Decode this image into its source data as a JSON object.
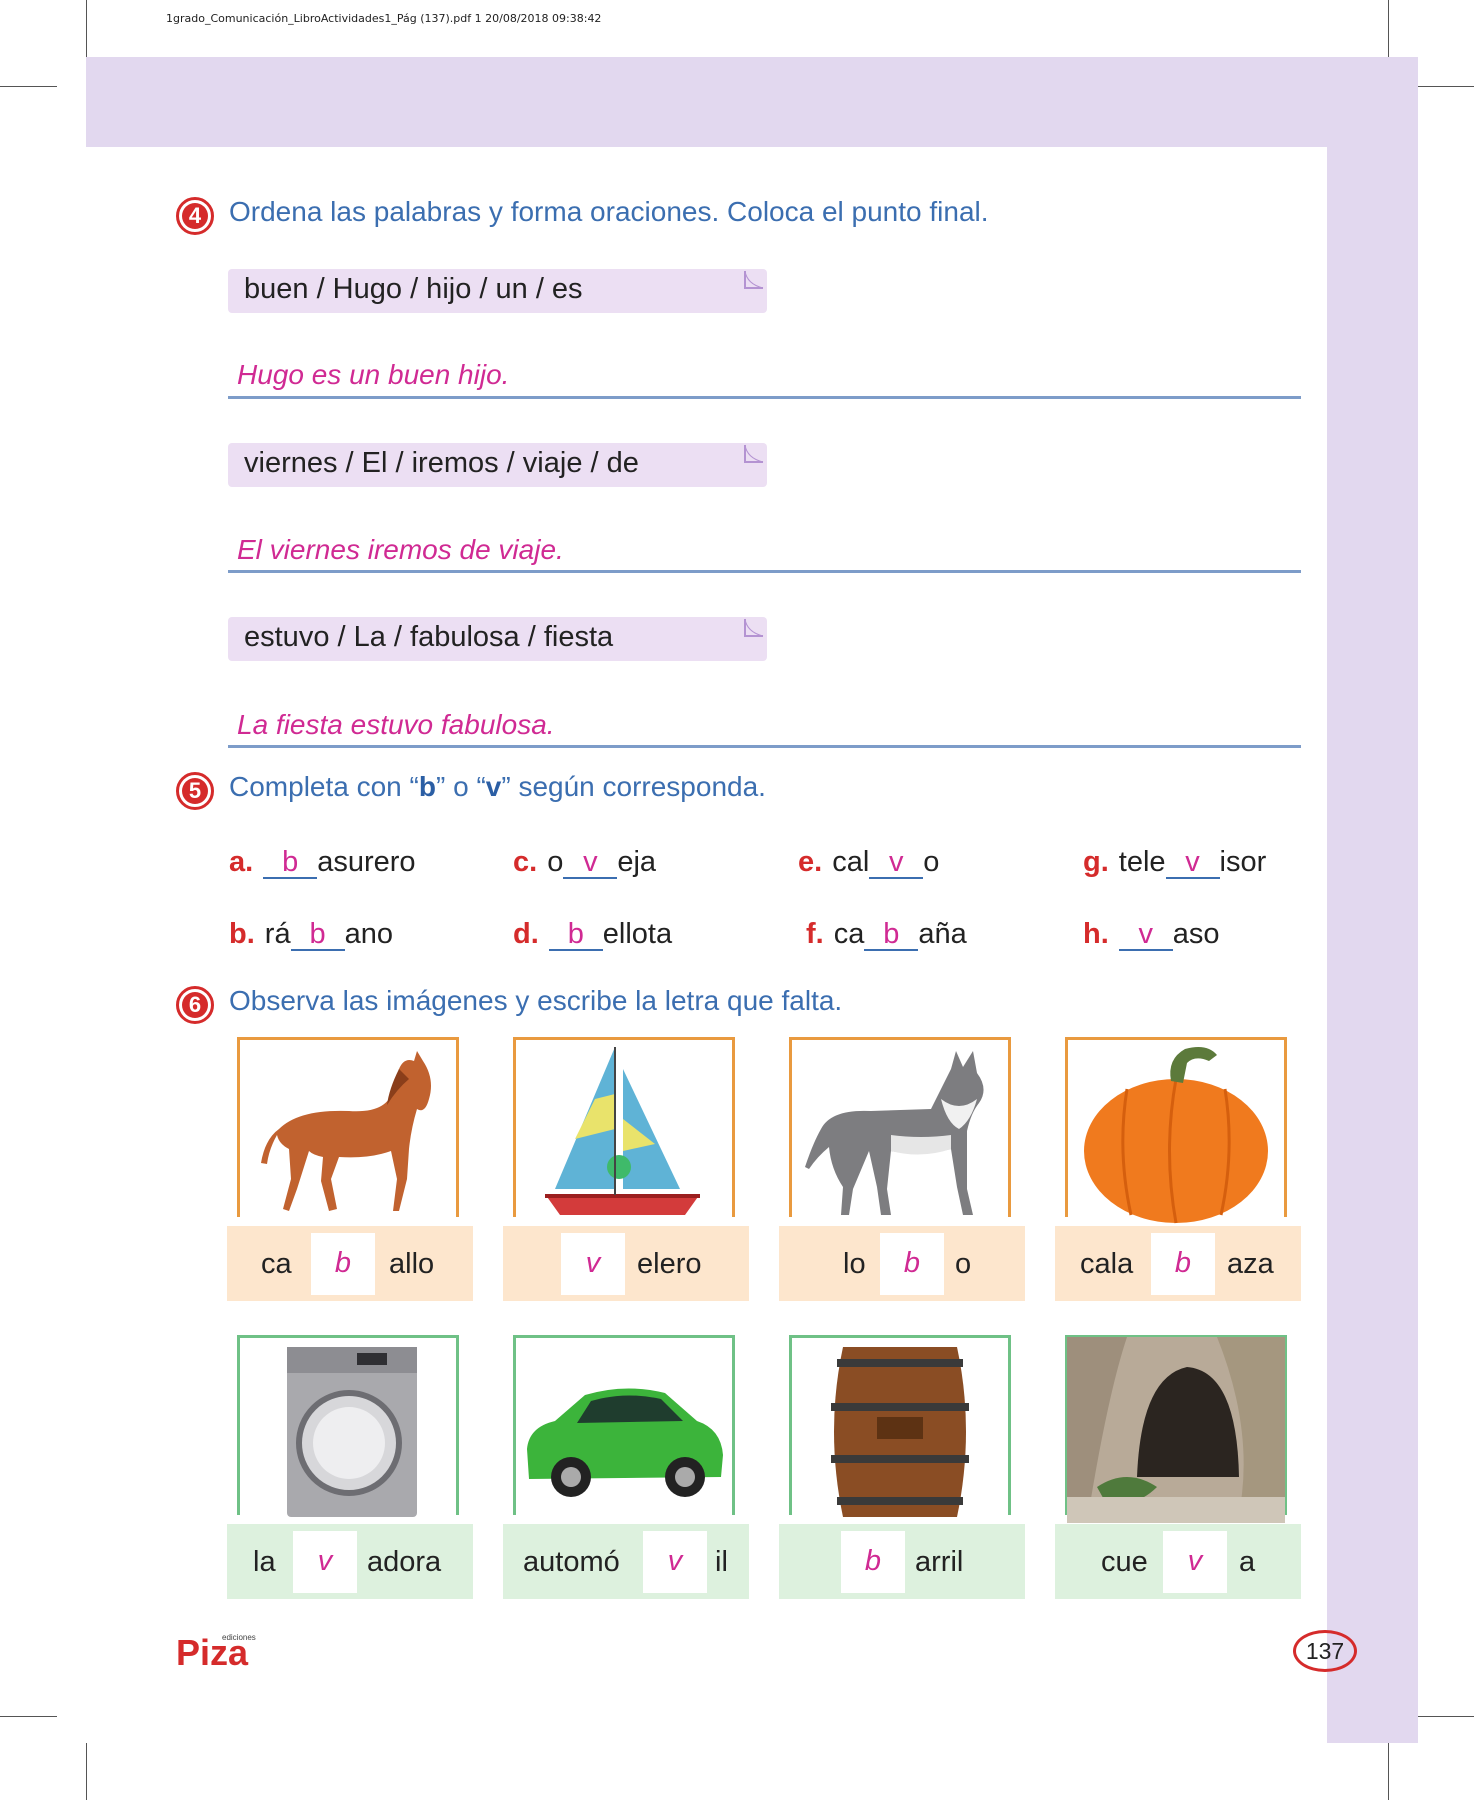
{
  "file_header": "1grado_Comunicación_LibroActividades1_Pág (137).pdf   1   20/08/2018   09:38:42",
  "section4": {
    "number": "4",
    "instruction": "Ordena las palabras y forma oraciones. Coloca el punto final.",
    "items": [
      {
        "words": "buen / Hugo / hijo / un / es",
        "answer": "Hugo es un buen hijo."
      },
      {
        "words": "viernes / El / iremos / viaje / de",
        "answer": "El viernes iremos de viaje."
      },
      {
        "words": "estuvo / La / fabulosa / fiesta",
        "answer": "La fiesta estuvo fabulosa."
      }
    ]
  },
  "section5": {
    "number": "5",
    "instruction_pre": "Completa con “",
    "letter_b": "b",
    "instruction_mid": "” o “",
    "letter_v": "v",
    "instruction_post": "” según corresponda.",
    "items": [
      {
        "label": "a.",
        "before": "",
        "fill": "b",
        "after": "asurero"
      },
      {
        "label": "c.",
        "before": "o",
        "fill": "v",
        "after": "eja"
      },
      {
        "label": "e.",
        "before": "cal",
        "fill": "v",
        "after": "o"
      },
      {
        "label": "g.",
        "before": "tele",
        "fill": "v",
        "after": "isor"
      },
      {
        "label": "b.",
        "before": "rá",
        "fill": "b",
        "after": "ano"
      },
      {
        "label": "d.",
        "before": "",
        "fill": "b",
        "after": "ellota"
      },
      {
        "label": "f.",
        "before": "ca",
        "fill": "b",
        "after": "aña"
      },
      {
        "label": "h.",
        "before": "",
        "fill": "v",
        "after": "aso"
      }
    ]
  },
  "section6": {
    "number": "6",
    "instruction": "Observa las imágenes y escribe la letra que falta.",
    "cards": [
      {
        "image": "horse",
        "before": "ca",
        "fill": "b",
        "after": "allo"
      },
      {
        "image": "sailboat",
        "before": "",
        "fill": "v",
        "after": "elero"
      },
      {
        "image": "wolf",
        "before": "lo",
        "fill": "b",
        "after": "o"
      },
      {
        "image": "pumpkin",
        "before": "cala",
        "fill": "b",
        "after": "aza"
      },
      {
        "image": "washing-machine",
        "before": "la",
        "fill": "v",
        "after": "adora"
      },
      {
        "image": "car",
        "before": "automó",
        "fill": "v",
        "after": "il"
      },
      {
        "image": "barrel",
        "before": "",
        "fill": "b",
        "after": "arril"
      },
      {
        "image": "cave",
        "before": "cue",
        "fill": "v",
        "after": "a"
      }
    ]
  },
  "footer": {
    "logo_text": "Piza",
    "logo_small": "ediciones",
    "page_number": "137"
  },
  "colors": {
    "band": "#e2d8ef",
    "instruction": "#3b6eb0",
    "answer": "#d02a93",
    "badge": "#d52b2b",
    "card_orange": "#e99a3f",
    "card_green": "#6fc186"
  }
}
